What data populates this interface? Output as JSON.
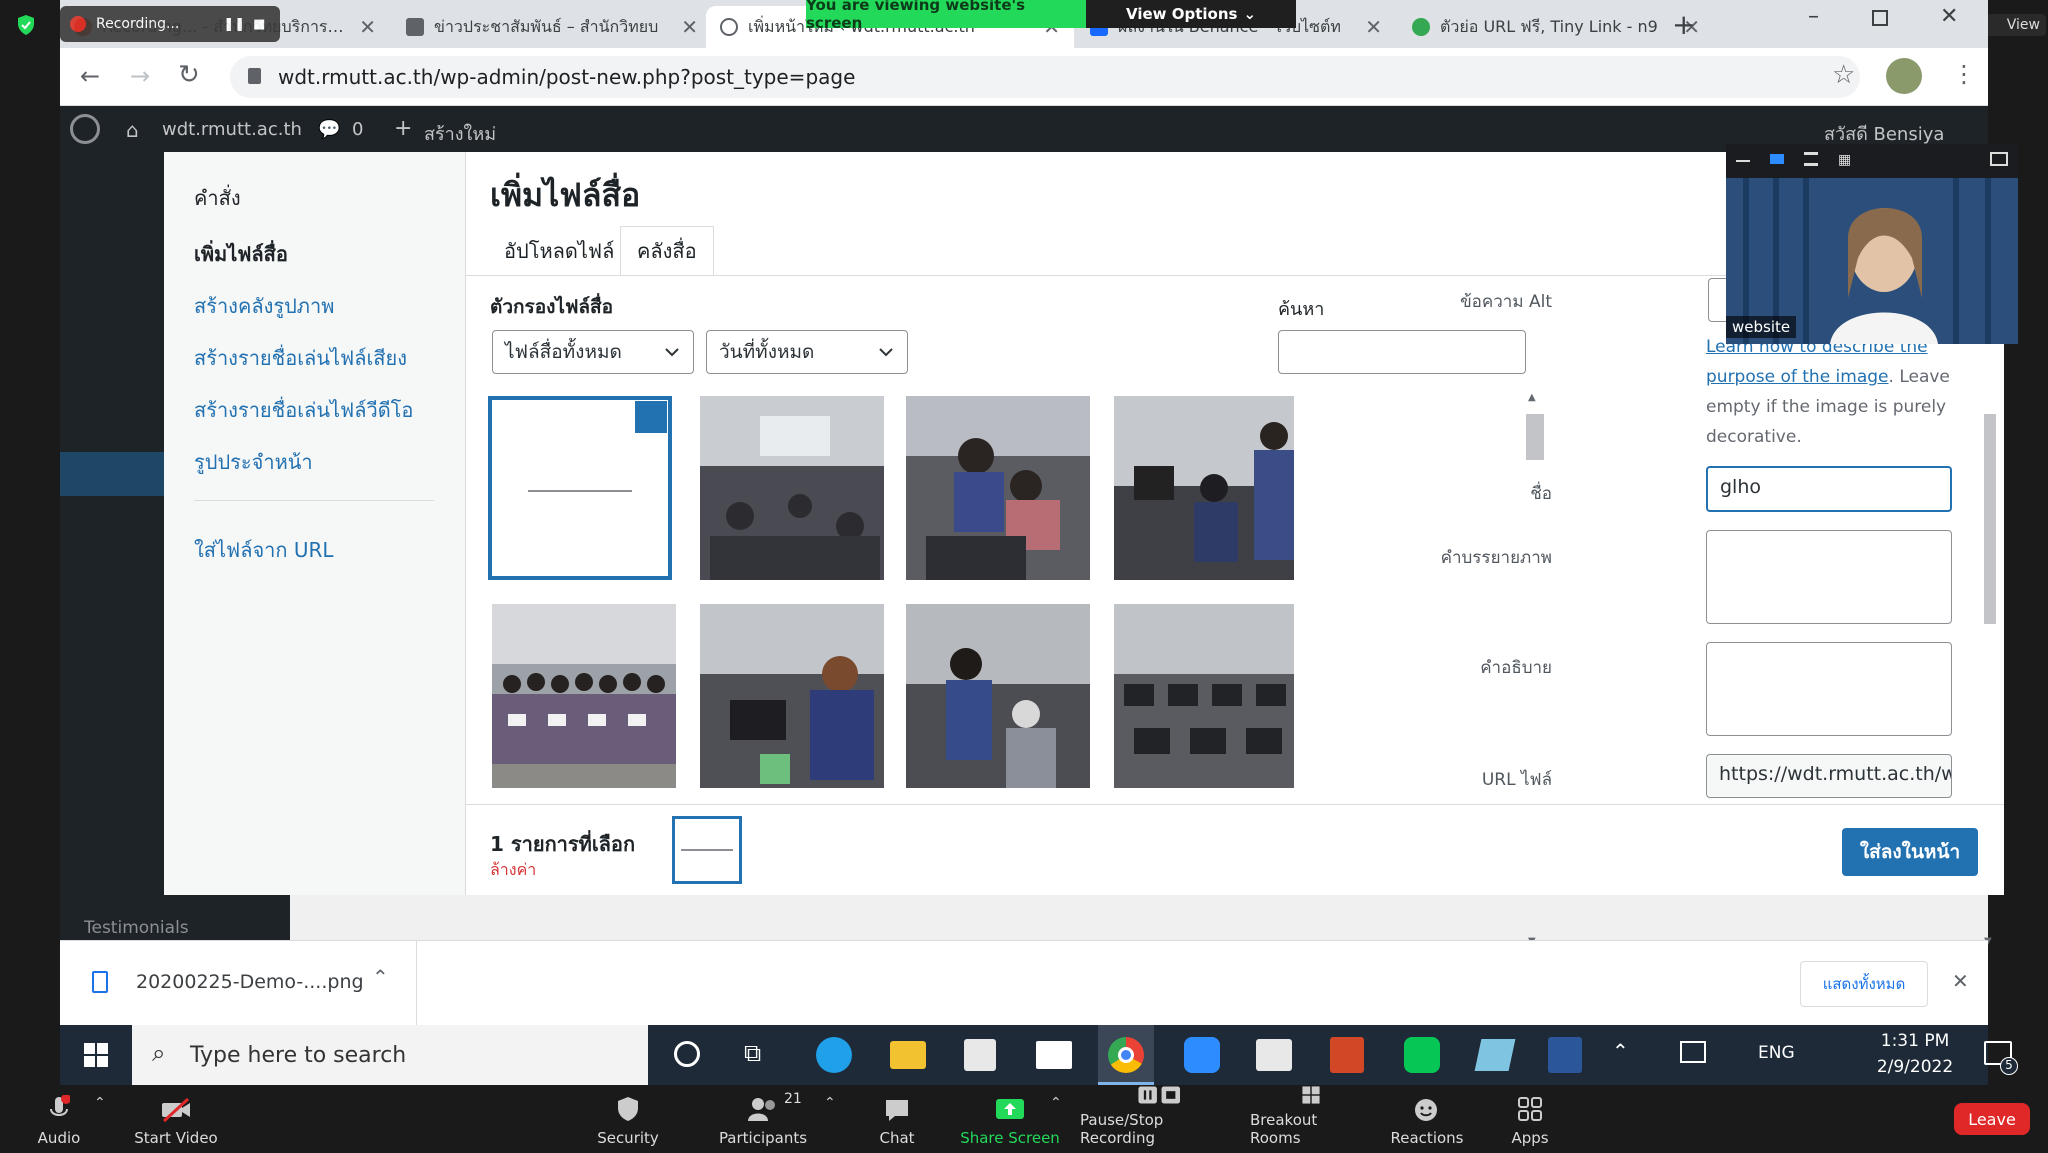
{
  "browser": {
    "tabs": [
      {
        "title": "Recording... - สำนักวิทยบริการและ",
        "favicon_color": "#d93025"
      },
      {
        "title": "ข่าวประชาสัมพันธ์ – สำนักวิทยบ",
        "favicon_color": "#5f6368"
      },
      {
        "title": "เพิ่มหน้าใหม่ ‹ wdt.rmutt.ac.th",
        "favicon_color": "#5f6368",
        "active": true
      },
      {
        "title": "ผลงานใน Behance – เว็บไซต์ท",
        "favicon_color": "#1769ff"
      },
      {
        "title": "ตัวย่อ URL ฟรี, Tiny Link - n9",
        "favicon_color": "#34a853"
      }
    ],
    "new_tab_icon": "plus-icon",
    "recording_label": "Recording...",
    "url": "wdt.rmutt.ac.th/wp-admin/post-new.php?post_type=page"
  },
  "zoom_share": {
    "viewing_message": "You are viewing website's screen",
    "view_options": "View Options",
    "video_name": "website",
    "view_label": "View"
  },
  "wp_admin_bar": {
    "site": "wdt.rmutt.ac.th",
    "comments": "0",
    "new_label": "สร้างใหม่",
    "greeting": "สวัสดี Bensiya"
  },
  "wp_sidebar": {
    "testimonials": "Testimonials"
  },
  "media_modal": {
    "menu": {
      "actions_heading": "คำสั่ง",
      "items": [
        "เพิ่มไฟล์สื่อ",
        "สร้างคลังรูปภาพ",
        "สร้างรายชื่อเล่นไฟล์เสียง",
        "สร้างรายชื่อเล่นไฟล์วีดีโอ",
        "รูปประจำหน้า"
      ],
      "insert_from_url": "ใส่ไฟล์จาก URL"
    },
    "title": "เพิ่มไฟล์สื่อ",
    "tabs": [
      "อัปโหลดไฟล์",
      "คลังสื่อ"
    ],
    "filter_label": "ตัวกรองไฟล์สื่อ",
    "filter_type": "ไฟล์สื่อทั้งหมด",
    "filter_date": "วันที่ทั้งหมด",
    "search_label": "ค้นหา",
    "search_value": "",
    "details": {
      "alt_label": "ข้อความ Alt",
      "alt_value": "",
      "help_link": "Learn how to describe the purpose of the image",
      "help_rest": ". Leave empty if the image is purely decorative.",
      "title_label": "ชื่อ",
      "title_value": "glho",
      "caption_label": "คำบรรยายภาพ",
      "caption_value": "",
      "description_label": "คำอธิบาย",
      "description_value": "",
      "url_label": "URL ไฟล์",
      "url_value": "https://wdt.rmutt.ac.th/w|"
    },
    "selection_count": "1 รายการที่เลือก",
    "clear_label": "ล้างค่า",
    "insert_button": "ใส่ลงในหน้า"
  },
  "download_bar": {
    "filename": "20200225-Demo-....png",
    "show_all": "แสดงทั้งหมด"
  },
  "taskbar": {
    "search_placeholder": "Type here to search",
    "language": "ENG",
    "time": "1:31 PM",
    "date": "2/9/2022",
    "notification_count": "5"
  },
  "zoom_bar": {
    "audio": "Audio",
    "start_video": "Start Video",
    "security": "Security",
    "participants": "Participants",
    "participants_count": "21",
    "chat": "Chat",
    "share_screen": "Share Screen",
    "pause_recording": "Pause/Stop Recording",
    "breakout_rooms": "Breakout Rooms",
    "reactions": "Reactions",
    "apps": "Apps",
    "leave": "Leave"
  },
  "colors": {
    "wp_blue": "#2271b1",
    "zoom_green": "#23d959",
    "leave_red": "#e02828",
    "wp_dark": "#1d2327"
  }
}
